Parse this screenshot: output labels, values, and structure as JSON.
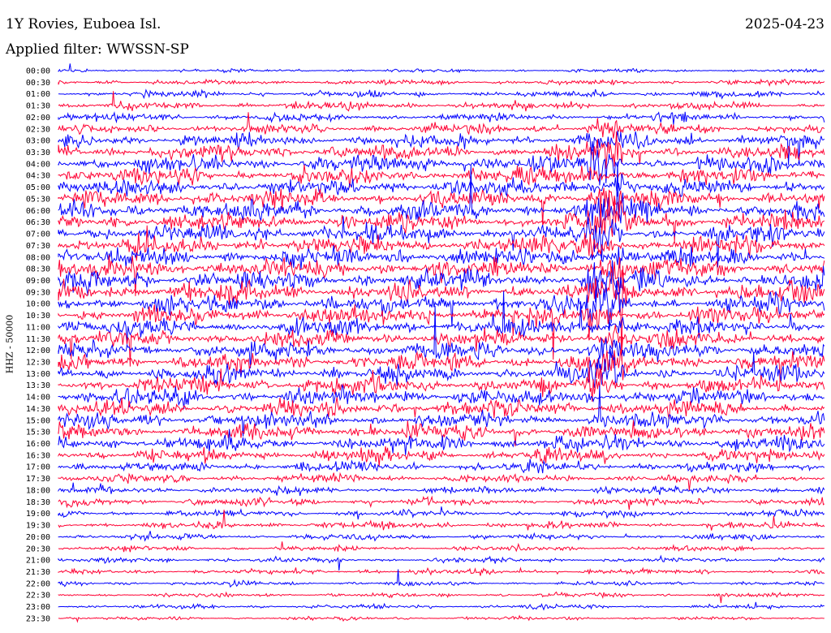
{
  "header": {
    "station": "1Y Rovies, Euboea Isl.",
    "filter": "Applied filter: WWSSN-SP",
    "date": "2025-04-23"
  },
  "channel_label": "HHZ - 50000",
  "colors": {
    "trace_a": "#0000ff",
    "trace_b": "#ff0033",
    "background": "#ffffff",
    "text": "#000000"
  },
  "chart_data": {
    "type": "helicorder",
    "title": "1Y Rovies, Euboea Isl.",
    "subtitle": "Applied filter: WWSSN-SP",
    "date": "2025-04-23",
    "ylabel": "HHZ - 50000",
    "row_interval_minutes": 30,
    "series_colors": [
      "#0000ff",
      "#ff0033"
    ],
    "row_labels": [
      "00:00",
      "00:30",
      "01:00",
      "01:30",
      "02:00",
      "02:30",
      "03:00",
      "03:30",
      "04:00",
      "04:30",
      "05:00",
      "05:30",
      "06:00",
      "06:30",
      "07:00",
      "07:30",
      "08:00",
      "08:30",
      "09:00",
      "09:30",
      "10:00",
      "10:30",
      "11:00",
      "11:30",
      "12:00",
      "12:30",
      "13:00",
      "13:30",
      "14:00",
      "14:30",
      "15:00",
      "15:30",
      "16:00",
      "16:30",
      "17:00",
      "17:30",
      "18:00",
      "18:30",
      "19:00",
      "19:30",
      "20:00",
      "20:30",
      "21:00",
      "21:30",
      "22:00",
      "22:30",
      "23:00",
      "23:30"
    ],
    "relative_amplitude": [
      0.4,
      0.6,
      0.8,
      0.9,
      1.0,
      1.2,
      1.6,
      1.8,
      2.0,
      2.0,
      2.0,
      2.1,
      2.2,
      2.2,
      2.2,
      2.2,
      2.3,
      2.3,
      2.4,
      2.3,
      2.2,
      2.2,
      2.1,
      2.0,
      2.0,
      2.0,
      2.0,
      2.0,
      2.0,
      1.9,
      1.9,
      1.9,
      1.8,
      1.6,
      1.2,
      1.0,
      0.9,
      0.9,
      0.8,
      0.8,
      0.7,
      0.6,
      0.6,
      0.6,
      0.5,
      0.5,
      0.5,
      0.4
    ]
  }
}
